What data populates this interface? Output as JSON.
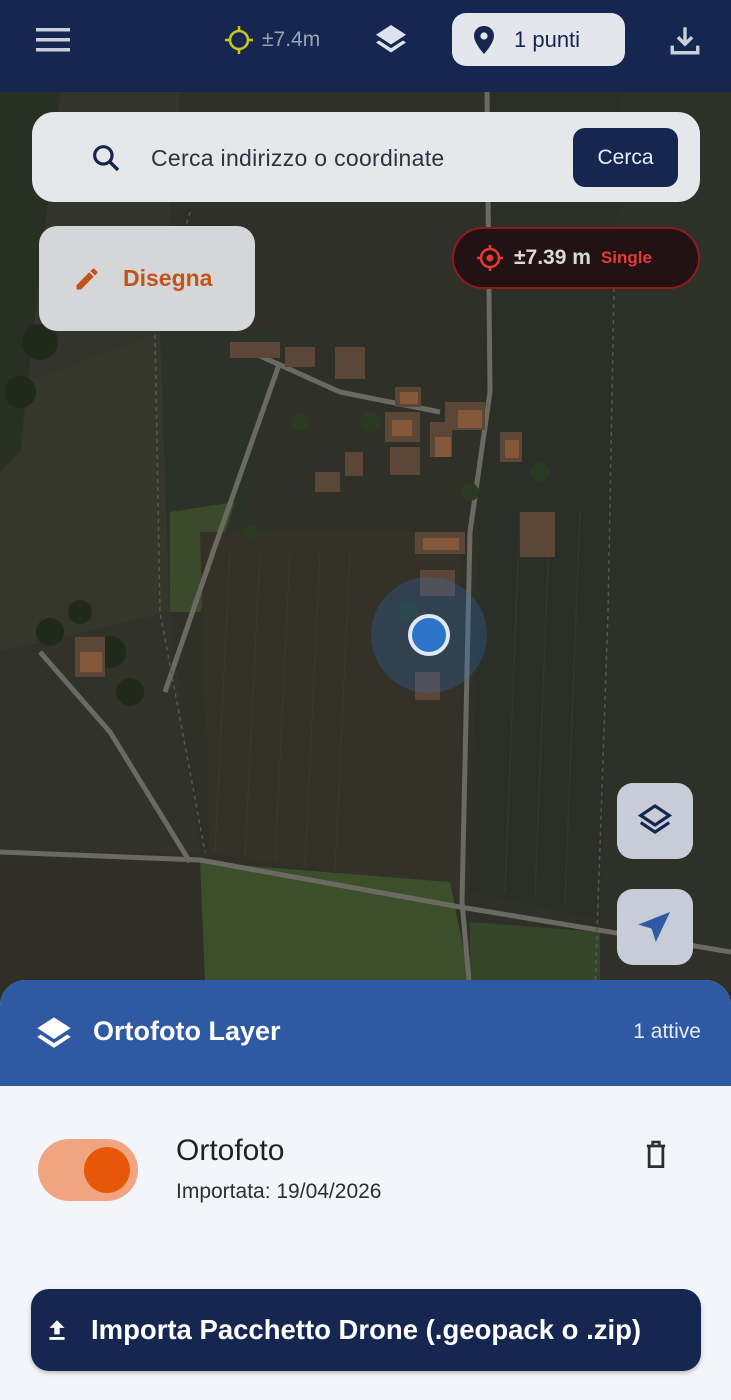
{
  "topbar": {
    "gps_accuracy": "±7.4m",
    "points_label": "1 punti"
  },
  "search": {
    "placeholder": "Cerca indirizzo o coordinate",
    "button_label": "Cerca"
  },
  "draw_button": {
    "label": "Disegna"
  },
  "accuracy_indicator": {
    "value": "±7.39 m",
    "mode": "Single"
  },
  "layer_panel": {
    "title": "Ortofoto Layer",
    "active_count": "1 attive",
    "layers": [
      {
        "name": "Ortofoto",
        "imported": "Importata: 19/04/2026",
        "enabled": true
      }
    ],
    "import_label": "Importa Pacchetto Drone (.geopack o .zip)"
  },
  "icons": {
    "menu": "menu-icon",
    "gps": "gps-crosshair-icon",
    "layers": "layers-icon",
    "location": "location-pin-icon",
    "download": "download-icon",
    "search": "search-icon",
    "draw": "pencil-icon",
    "accuracy": "target-icon",
    "navigation": "navigation-arrow-icon",
    "delete": "trash-icon",
    "upload": "upload-icon"
  },
  "colors": {
    "appbar": "#152750",
    "panel_header": "#2f5aa3",
    "accent_orange": "#e65708",
    "draw_text": "#c25418",
    "accuracy_red": "#e53935",
    "gps_yellow": "#c9c61f",
    "user_location": "#2b74c7"
  }
}
